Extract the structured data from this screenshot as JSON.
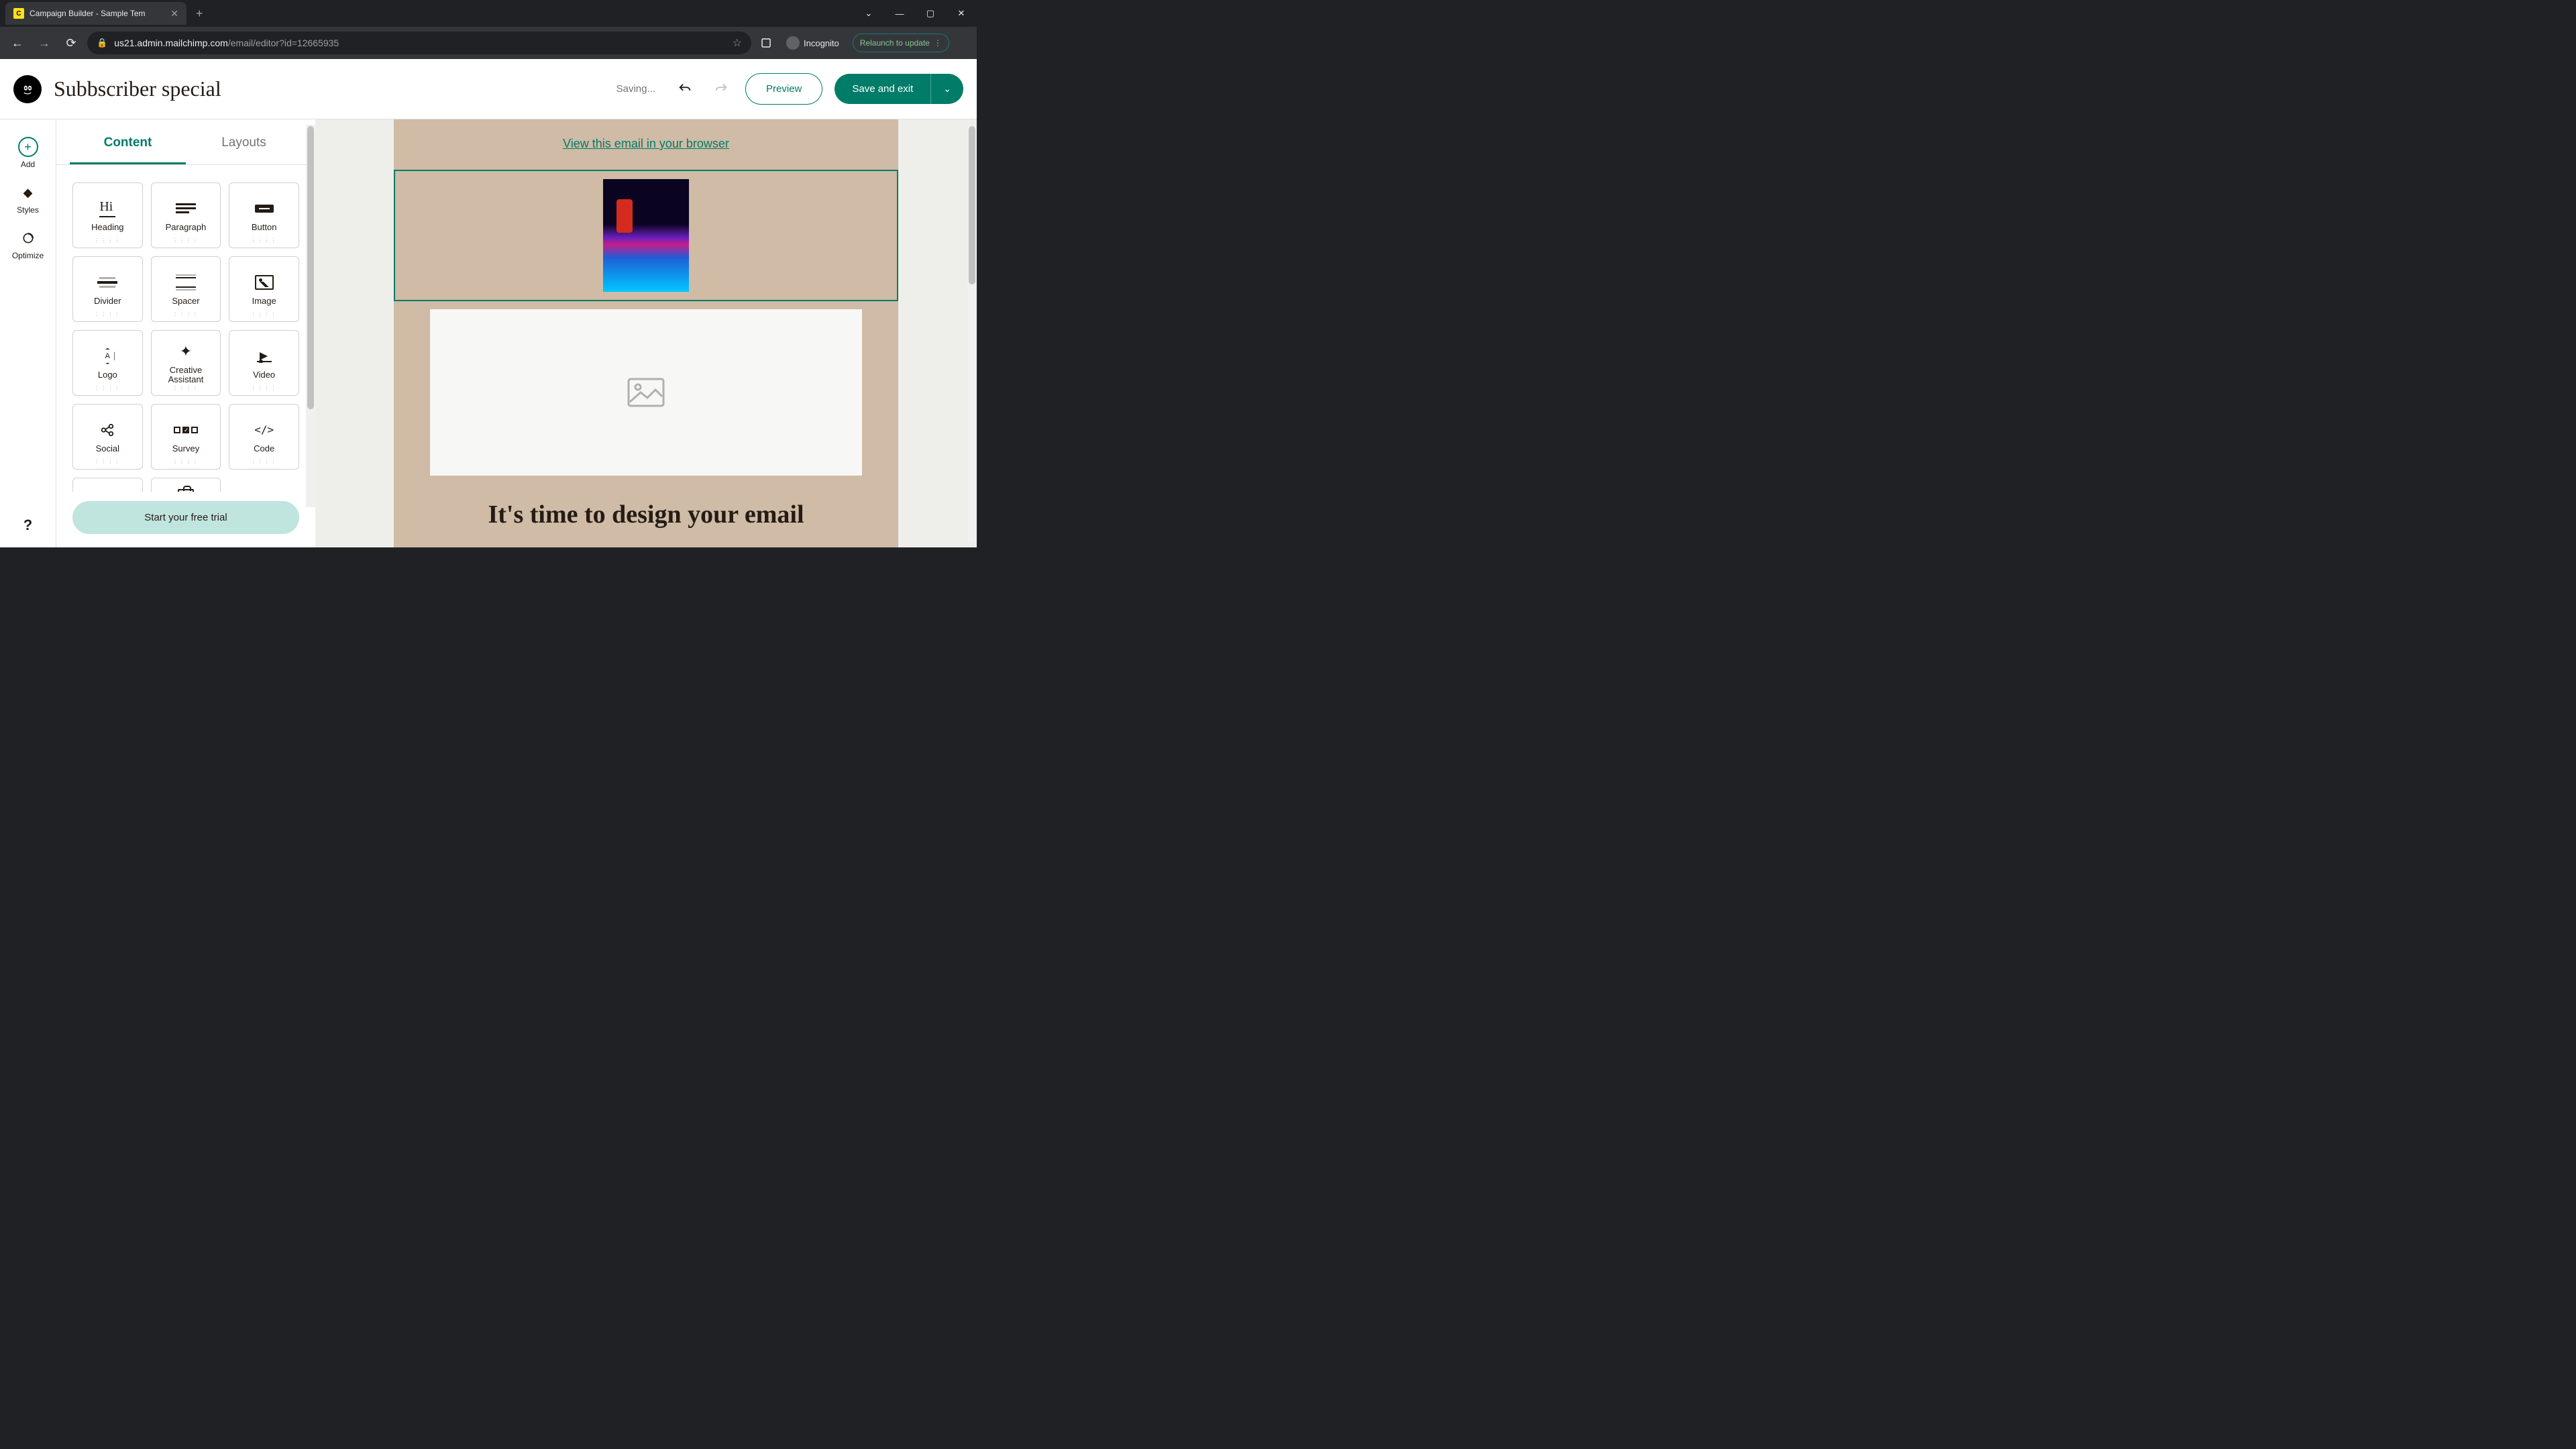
{
  "browser": {
    "tab_title": "Campaign Builder - Sample Tem",
    "url_host": "us21.admin.mailchimp.com",
    "url_path": "/email/editor?id=12665935",
    "incognito_label": "Incognito",
    "relaunch_label": "Relaunch to update"
  },
  "header": {
    "campaign_title": "Subbscriber special",
    "saving_label": "Saving...",
    "preview_label": "Preview",
    "save_label": "Save and exit"
  },
  "rail": {
    "add": "Add",
    "styles": "Styles",
    "optimize": "Optimize",
    "help": "?"
  },
  "sidebar": {
    "tabs": {
      "content": "Content",
      "layouts": "Layouts"
    },
    "blocks": [
      {
        "id": "heading",
        "label": "Heading"
      },
      {
        "id": "paragraph",
        "label": "Paragraph"
      },
      {
        "id": "button",
        "label": "Button"
      },
      {
        "id": "divider",
        "label": "Divider"
      },
      {
        "id": "spacer",
        "label": "Spacer"
      },
      {
        "id": "image",
        "label": "Image"
      },
      {
        "id": "logo",
        "label": "Logo"
      },
      {
        "id": "creative",
        "label": "Creative\nAssistant"
      },
      {
        "id": "video",
        "label": "Video"
      },
      {
        "id": "social",
        "label": "Social"
      },
      {
        "id": "survey",
        "label": "Survey"
      },
      {
        "id": "code",
        "label": "Code"
      }
    ],
    "trial_cta": "Start your free trial"
  },
  "canvas": {
    "view_in_browser": "View this email in your browser",
    "headline": "It's time to design your email"
  },
  "colors": {
    "accent": "#007c68",
    "canvas_bg": "#cfbba6"
  }
}
